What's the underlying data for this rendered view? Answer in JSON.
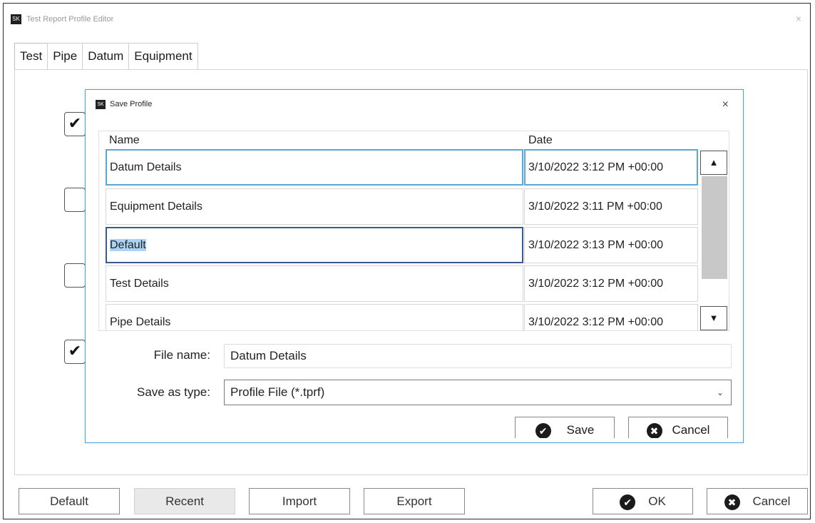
{
  "window": {
    "title": "Test Report Profile Editor",
    "app_icon_text": "SK",
    "close_glyph": "×"
  },
  "tabs": [
    {
      "label": "Test",
      "active": true
    },
    {
      "label": "Pipe",
      "active": false
    },
    {
      "label": "Datum",
      "active": false
    },
    {
      "label": "Equipment",
      "active": false
    }
  ],
  "background_checkboxes": [
    {
      "checked": true
    },
    {
      "checked": false
    },
    {
      "checked": false
    },
    {
      "checked": true
    }
  ],
  "bottom_buttons": {
    "default": "Default",
    "recent": "Recent",
    "import": "Import",
    "export": "Export",
    "ok": "OK",
    "cancel": "Cancel"
  },
  "dialog": {
    "title": "Save Profile",
    "icon_text": "SK",
    "close_glyph": "×",
    "columns": {
      "name": "Name",
      "date": "Date"
    },
    "rows": [
      {
        "name": "Datum Details",
        "date": "3/10/2022 3:12 PM +00:00"
      },
      {
        "name": "Equipment Details",
        "date": "3/10/2022 3:11 PM +00:00"
      },
      {
        "name": "Default",
        "date": "3/10/2022 3:13 PM +00:00"
      },
      {
        "name": "Test Details",
        "date": "3/10/2022 3:12 PM +00:00"
      },
      {
        "name": "Pipe Details",
        "date": "3/10/2022 3:12 PM +00:00"
      }
    ],
    "file_name_label": "File name:",
    "file_name_value": "Datum Details",
    "save_as_type_label": "Save as type:",
    "save_as_type_value": "Profile File (*.tprf)",
    "save_label": "Save",
    "cancel_label": "Cancel"
  },
  "icons": {
    "check": "✔",
    "x": "✖",
    "up": "▲",
    "down": "▼",
    "dropdown": "⌄"
  },
  "colors": {
    "selection_highlight": "#aad3f5",
    "dialog_border": "#4aa0d8",
    "focused_cell_border": "#5aa7d8"
  }
}
